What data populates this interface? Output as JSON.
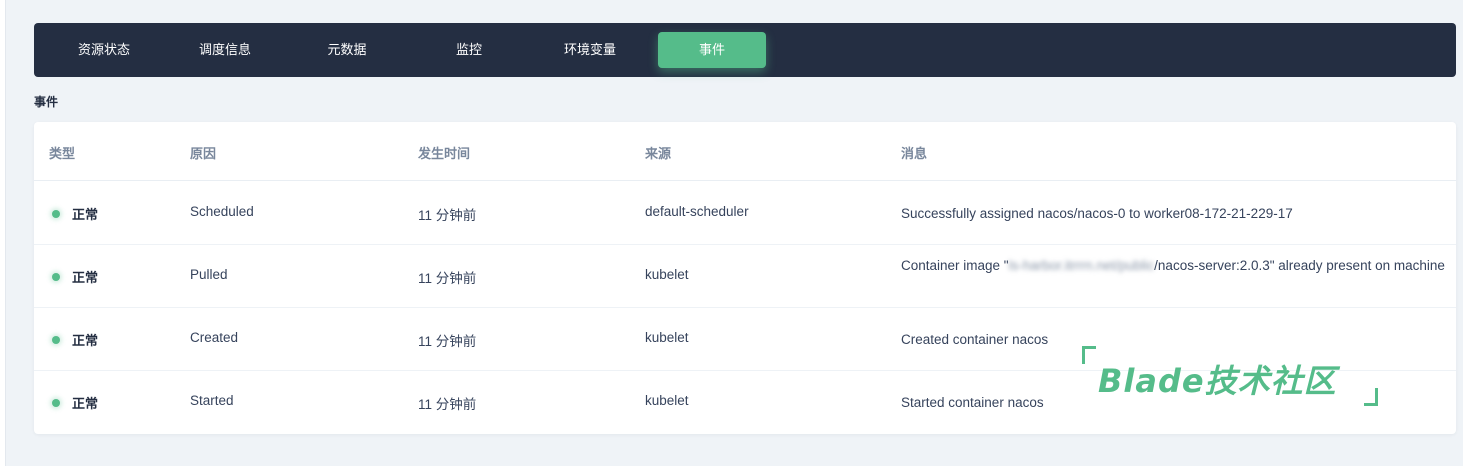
{
  "tabs": [
    {
      "label": "资源状态",
      "active": false
    },
    {
      "label": "调度信息",
      "active": false
    },
    {
      "label": "元数据",
      "active": false
    },
    {
      "label": "监控",
      "active": false
    },
    {
      "label": "环境变量",
      "active": false
    },
    {
      "label": "事件",
      "active": true
    }
  ],
  "section_title": "事件",
  "columns": [
    "类型",
    "原因",
    "发生时间",
    "来源",
    "消息"
  ],
  "rows": [
    {
      "type": "正常",
      "reason": "Scheduled",
      "time": "11 分钟前",
      "source": "default-scheduler",
      "message": "Successfully assigned nacos/nacos-0 to worker08-172-21-229-17"
    },
    {
      "type": "正常",
      "reason": "Pulled",
      "time": "11 分钟前",
      "source": "kubelet",
      "message_prefix": "Container image \"",
      "message_blurred": "ls-harbor.itrrrn.net/public",
      "message_suffix": "/nacos-server:2.0.3\" already present on machine"
    },
    {
      "type": "正常",
      "reason": "Created",
      "time": "11 分钟前",
      "source": "kubelet",
      "message": "Created container nacos"
    },
    {
      "type": "正常",
      "reason": "Started",
      "time": "11 分钟前",
      "source": "kubelet",
      "message": "Started container nacos"
    }
  ],
  "watermark": "Blade技术社区",
  "colors": {
    "tabbar_bg": "#242e42",
    "accent": "#55bc8a",
    "page_bg": "#eff3f7"
  }
}
